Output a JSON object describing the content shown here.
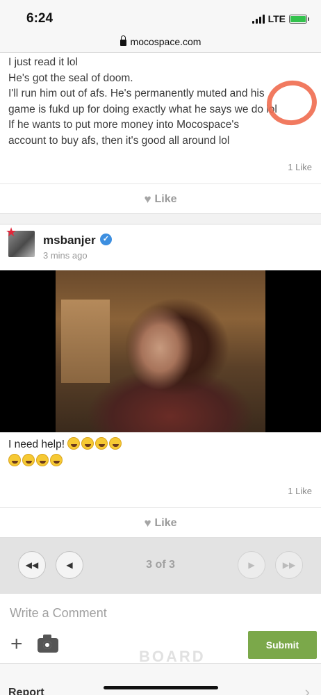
{
  "status": {
    "time": "6:24",
    "network": "LTE"
  },
  "browser": {
    "url": "mocospace.com"
  },
  "post1": {
    "lines": [
      "I just read it lol",
      "He's got the seal of doom.",
      "I'll run him out of afs. He's permanently muted and his",
      "game is fukd up for doing exactly what he says we do lol",
      "If he wants to put more money into Mocospace's",
      "account to buy afs, then it's good all around lol"
    ],
    "likes": "1 Like",
    "like_label": "Like"
  },
  "post2": {
    "username": "msbanjer",
    "time_ago": "3 mins ago",
    "text": "I need help!",
    "likes": "1 Like",
    "like_label": "Like"
  },
  "pager": {
    "page_label": "3 of 3",
    "first_icon": "double-chevron-left-icon",
    "prev_icon": "chevron-left-icon",
    "next_icon": "chevron-right-icon",
    "last_icon": "double-chevron-right-icon"
  },
  "comment": {
    "placeholder": "Write a Comment",
    "submit_label": "Submit",
    "watermark": "BOARD"
  },
  "report": {
    "label": "Report"
  },
  "colors": {
    "submit": "#7ba84a",
    "verified": "#3d8fe0",
    "annotation_circle": "#ef6b4f"
  }
}
